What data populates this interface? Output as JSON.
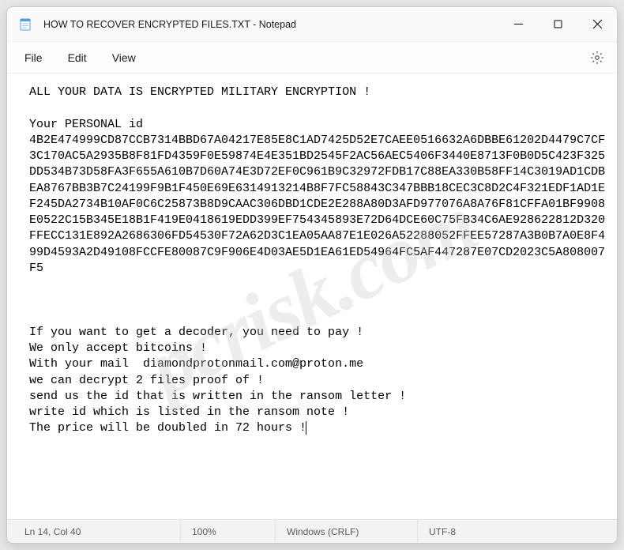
{
  "titlebar": {
    "title": "HOW TO RECOVER ENCRYPTED FILES.TXT - Notepad"
  },
  "menubar": {
    "file": "File",
    "edit": "Edit",
    "view": "View"
  },
  "content": {
    "line1": "ALL YOUR DATA IS ENCRYPTED MILITARY ENCRYPTION !",
    "line2": "",
    "line3": "Your PERSONAL id",
    "id": "4B2E474999CD87CCB7314BBD67A04217E85E8C1AD7425D52E7CAEE0516632A6DBBE61202D4479C7CF3C170AC5A2935B8F81FD4359F0E59874E4E351BD2545F2AC56AEC5406F3440E8713F0B0D5C423F325DD534B73D58FA3F655A610B7D60A74E3D72EF0C961B9C32972FDB17C88EA330B58FF14C3019AD1CDBEA8767BB3B7C24199F9B1F450E69E6314913214B8F7FC58843C347BBB18CEC3C8D2C4F321EDF1AD1EF245DA2734B10AF0C6C25873B8D9CAAC306DBD1CDE2E288A80D3AFD977076A8A76F81CFFA01BF9908E0522C15B345E18B1F419E0418619EDD399EF754345893E72D64DCE60C75FB34C6AE928622812D320FFECC131E892A2686306FD54530F72A62D3C1EA05AA87E1E026A52288052FFEE57287A3B0B7A0E8F499D4593A2D49108FCCFE80087C9F906E4D03AE5D1EA61ED54964FC5AF447287E07CD2023C5A808007F5",
    "gap1": "",
    "gap2": "",
    "gap3": "",
    "m1": "If you want to get a decoder, you need to pay !",
    "m2": "We only accept bitcoins !",
    "m3": "With your mail  diamondprotonmail.com@proton.me",
    "m4": "we can decrypt 2 files proof of !",
    "m5": "send us the id that is written in the ransom letter !",
    "m6": "write id which is listed in the ransom note !",
    "m7": "The price will be doubled in 72 hours !"
  },
  "statusbar": {
    "position": "Ln 14, Col 40",
    "zoom": "100%",
    "lineending": "Windows (CRLF)",
    "encoding": "UTF-8"
  },
  "watermark": "pcrisk.com"
}
